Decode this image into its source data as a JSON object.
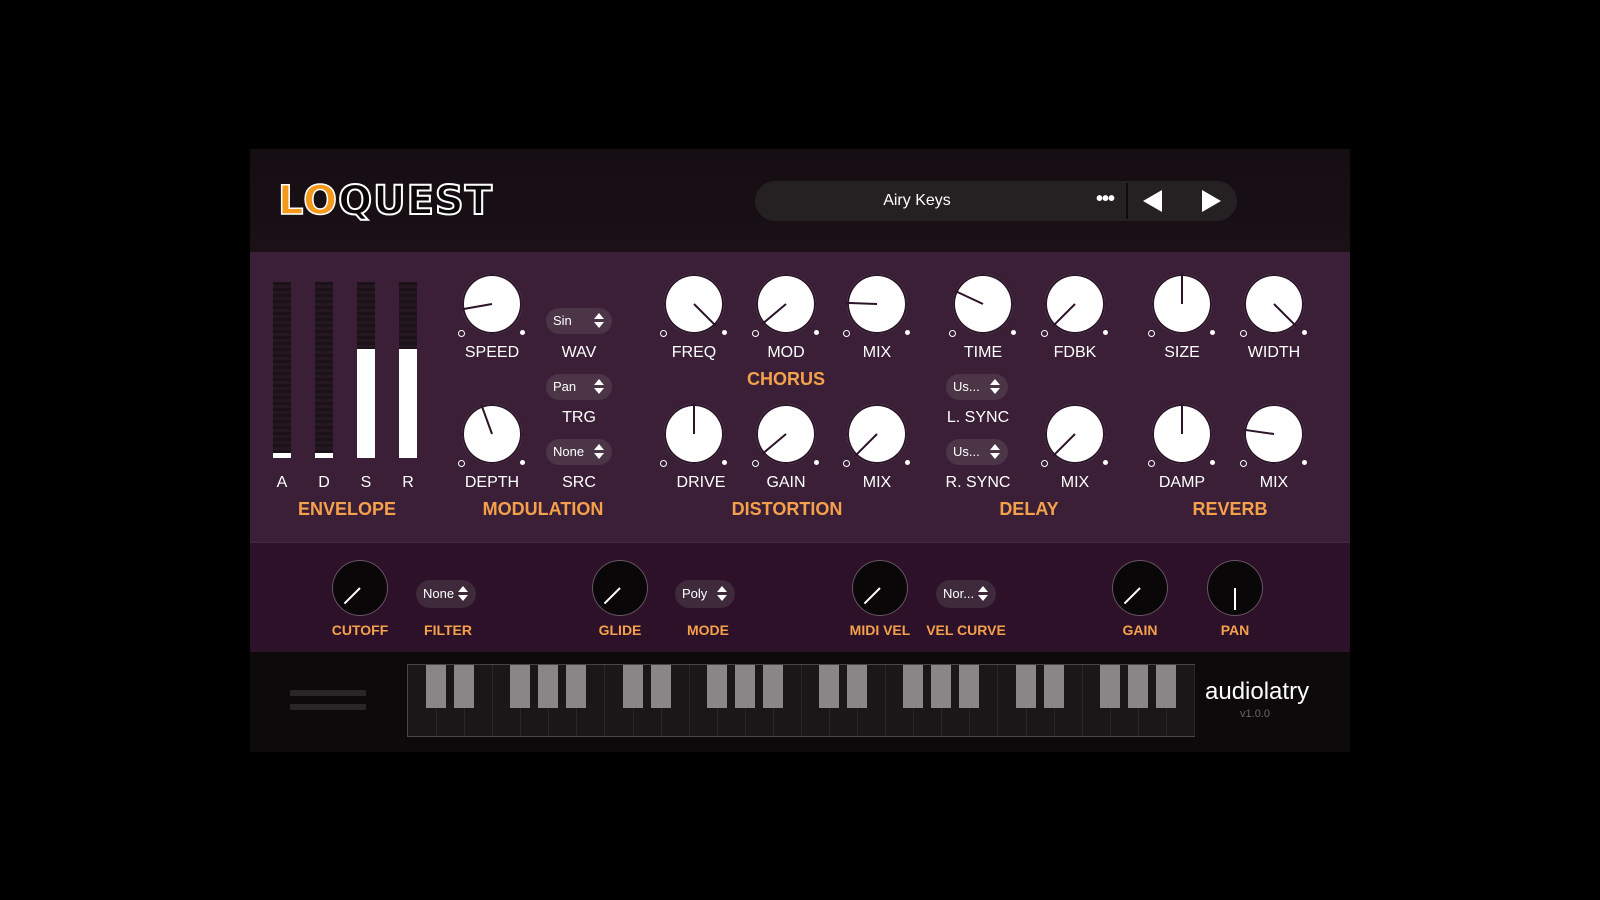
{
  "logo": {
    "part1": "LO",
    "part2": "QUEST"
  },
  "preset": {
    "name": "Airy Keys",
    "more": "•••"
  },
  "envelope": {
    "title": "ENVELOPE",
    "faders": [
      {
        "label": "A",
        "level": 0.03
      },
      {
        "label": "D",
        "level": 0.03
      },
      {
        "label": "S",
        "level": 0.62
      },
      {
        "label": "R",
        "level": 0.62
      }
    ]
  },
  "modulation": {
    "title": "MODULATION",
    "speed": {
      "label": "SPEED",
      "angle": -100
    },
    "depth": {
      "label": "DEPTH",
      "angle": -20
    },
    "wav": {
      "label": "WAV",
      "value": "Sin"
    },
    "trg": {
      "label": "TRG",
      "value": "Pan"
    },
    "src": {
      "label": "SRC",
      "value": "None"
    }
  },
  "chorus": {
    "title": "CHORUS",
    "freq": {
      "label": "FREQ",
      "angle": 135
    },
    "mod": {
      "label": "MOD",
      "angle": -130
    },
    "mix": {
      "label": "MIX",
      "angle": -88
    }
  },
  "distortion": {
    "title": "DISTORTION",
    "drive": {
      "label": "DRIVE",
      "angle": 0
    },
    "gain": {
      "label": "GAIN",
      "angle": -130
    },
    "mix": {
      "label": "MIX",
      "angle": -135
    }
  },
  "delay": {
    "title": "DELAY",
    "time": {
      "label": "TIME",
      "angle": -65
    },
    "fdbk": {
      "label": "FDBK",
      "angle": -135
    },
    "mix": {
      "label": "MIX",
      "angle": -135
    },
    "lsync": {
      "label": "L. SYNC",
      "value": "Us..."
    },
    "rsync": {
      "label": "R. SYNC",
      "value": "Us..."
    }
  },
  "reverb": {
    "title": "REVERB",
    "size": {
      "label": "SIZE",
      "angle": 0
    },
    "width": {
      "label": "WIDTH",
      "angle": 135
    },
    "damp": {
      "label": "DAMP",
      "angle": 0
    },
    "mix": {
      "label": "MIX",
      "angle": -82
    }
  },
  "bottom": {
    "cutoff": {
      "label": "CUTOFF",
      "angle": -135
    },
    "filter": {
      "label": "FILTER",
      "value": "None"
    },
    "glide": {
      "label": "GLIDE",
      "angle": -135
    },
    "mode": {
      "label": "MODE",
      "value": "Poly"
    },
    "midivel": {
      "label": "MIDI VEL",
      "angle": -135
    },
    "velcurve": {
      "label": "VEL CURVE",
      "value": "Nor..."
    },
    "gain": {
      "label": "GAIN",
      "angle": -135
    },
    "pan": {
      "label": "PAN",
      "angle": 180
    }
  },
  "footer": {
    "brand": "audiolatry",
    "version": "v1.0.0"
  },
  "colors": {
    "accent": "#f5a14c",
    "panel": "#3a1f36",
    "logo_orange": "#f39a1c"
  }
}
